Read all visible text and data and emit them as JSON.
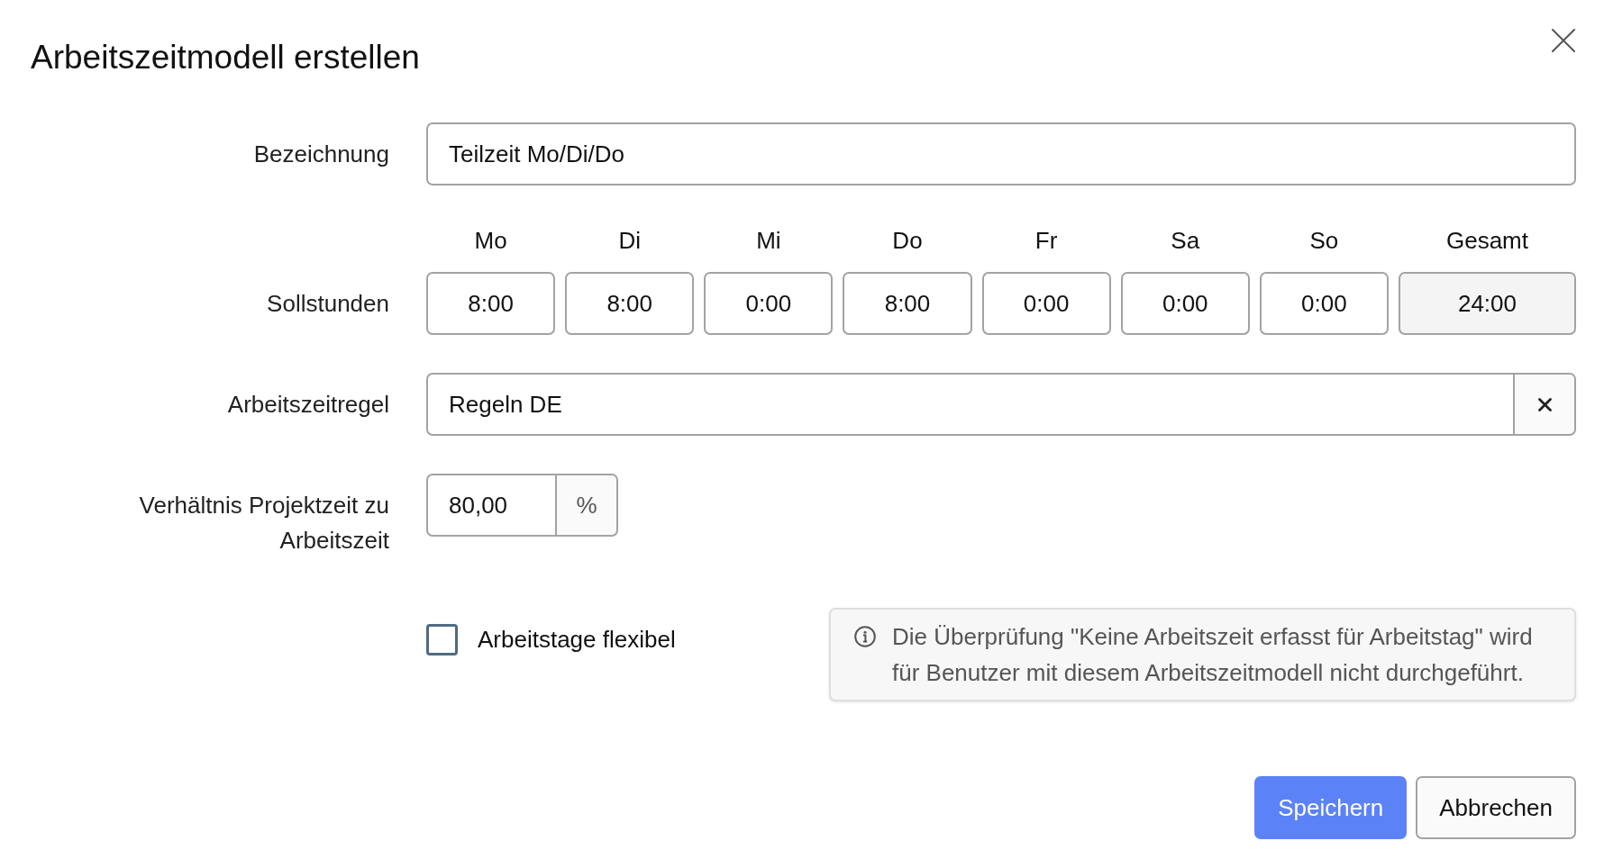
{
  "dialog": {
    "title": "Arbeitszeitmodell erstellen"
  },
  "form": {
    "name": {
      "label": "Bezeichnung",
      "value": "Teilzeit Mo/Di/Do"
    },
    "target_hours": {
      "label": "Sollstunden",
      "days": [
        {
          "day": "Mo",
          "value": "8:00"
        },
        {
          "day": "Di",
          "value": "8:00"
        },
        {
          "day": "Mi",
          "value": "0:00"
        },
        {
          "day": "Do",
          "value": "8:00"
        },
        {
          "day": "Fr",
          "value": "0:00"
        },
        {
          "day": "Sa",
          "value": "0:00"
        },
        {
          "day": "So",
          "value": "0:00"
        }
      ],
      "total": {
        "label": "Gesamt",
        "value": "24:00"
      }
    },
    "rule": {
      "label": "Arbeitszeitregel",
      "value": "Regeln DE"
    },
    "ratio": {
      "label": "Verhältnis Projektzeit zu Arbeitszeit",
      "value": "80,00",
      "unit": "%"
    },
    "flexible_days": {
      "label": "Arbeitstage flexibel",
      "checked": false
    },
    "info": {
      "text": "Die Überprüfung \"Keine Arbeitszeit erfasst für Arbeitstag\" wird für Benutzer mit diesem Arbeitszeitmodell nicht durchgeführt."
    }
  },
  "buttons": [
    {
      "label": "Speichern",
      "kind": "primary"
    },
    {
      "label": "Abbrechen",
      "kind": "secondary"
    }
  ]
}
